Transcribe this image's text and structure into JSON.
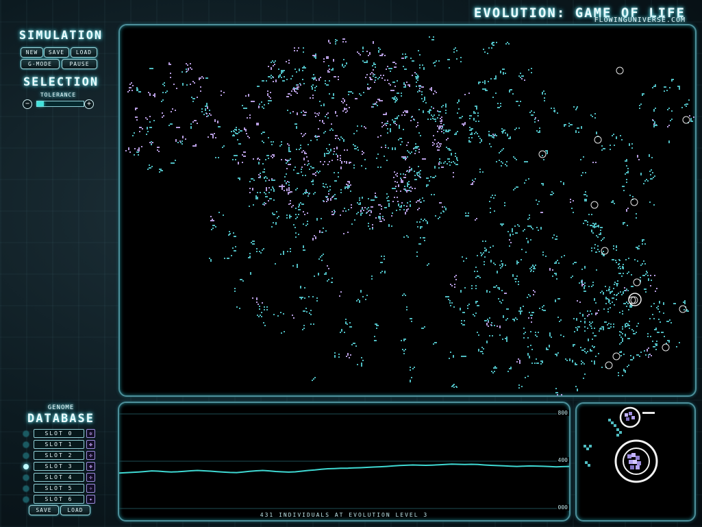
{
  "header": {
    "title": "Evolution: Game of Life",
    "url": "flowinguniverse.com"
  },
  "simulation": {
    "title": "Simulation",
    "buttons": {
      "new": "New",
      "save": "Save",
      "load": "Load",
      "g_mode": "G-Mode",
      "pause": "Pause"
    }
  },
  "selection": {
    "title": "Selection",
    "tolerance_label": "Tolerance",
    "minus": "−",
    "plus": "+",
    "tolerance_level": 0.15
  },
  "graph": {
    "top_value": "800",
    "mid_value": "400",
    "bottom_value": "000",
    "caption": "431 individuals at evolution level 3",
    "population_series": [
      300,
      303,
      306,
      309,
      313,
      318,
      316,
      312,
      309,
      311,
      314,
      319,
      322,
      319,
      316,
      312,
      308,
      305,
      304,
      309,
      314,
      319,
      322,
      318,
      313,
      310,
      308,
      310,
      316,
      322,
      326,
      332,
      336,
      338,
      340,
      341,
      343,
      345,
      348,
      351,
      353,
      356,
      360,
      364,
      366,
      368,
      367,
      365,
      367,
      370,
      373,
      375,
      374,
      373,
      374,
      372,
      368,
      365,
      363,
      361,
      358,
      356,
      358,
      360,
      359,
      357,
      355,
      352,
      354,
      356
    ],
    "y_max": 800
  },
  "genome": {
    "label": "Genome",
    "title": "Database",
    "slots": [
      {
        "label": "Slot 0",
        "active": false
      },
      {
        "label": "Slot 1",
        "active": false
      },
      {
        "label": "Slot 2",
        "active": false
      },
      {
        "label": "Slot 3",
        "active": true
      },
      {
        "label": "Slot 4",
        "active": false
      },
      {
        "label": "Slot 5",
        "active": false
      },
      {
        "label": "Slot 6",
        "active": false
      }
    ],
    "save": "Save",
    "load": "Load"
  },
  "colors": {
    "cyan_organism": "#4fbcc1",
    "violet_organism": "#b79de0",
    "graph_line": "#3fd9d3",
    "accent": "#43e2dc"
  }
}
